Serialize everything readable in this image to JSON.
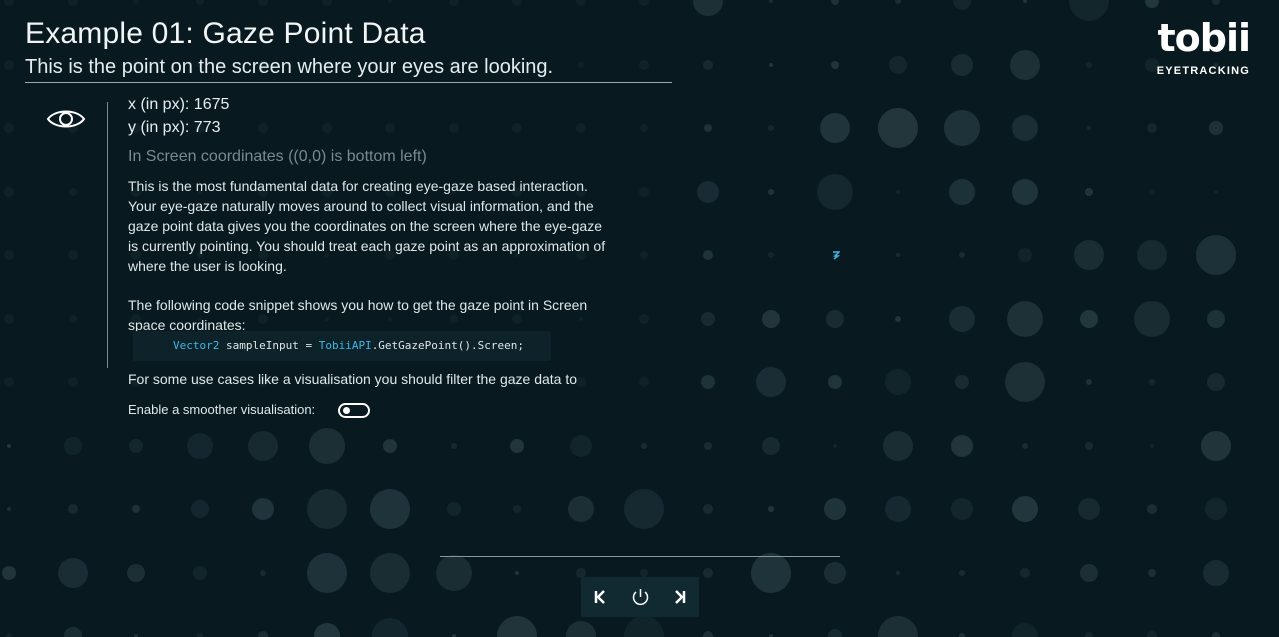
{
  "header": {
    "title": "Example 01: Gaze Point Data",
    "subtitle": "This is the point on the screen where your eyes are looking."
  },
  "logo": {
    "wordmark": "tobii",
    "tagline": "EYETRACKING"
  },
  "gaze": {
    "x_text": "x (in px): 1675",
    "y_text": "y (in px): 773",
    "coordinate_note": "In Screen coordinates ((0,0) is bottom left)"
  },
  "description": "This is the most fundamental data for creating eye-gaze based interaction. Your eye-gaze naturally moves around to collect visual information, and the gaze point data gives you the coordinates on the screen where the eye-gaze is currently pointing. You should treat each gaze point as an approximation of where the user is looking.",
  "snippet_intro": "The following code snippet shows you how to get the gaze point in Screen space coordinates:",
  "code": {
    "type": "Vector2",
    "var": " sampleInput = ",
    "api": "TobiiAPI",
    "rest": ".GetGazePoint().Screen;"
  },
  "filter_text": "For some use cases like a visualisation you should filter the gaze data to",
  "smoothing": {
    "label": "Enable a smoother visualisation:",
    "enabled": false
  },
  "nav": {
    "prev": "previous-example",
    "power": "exit",
    "next": "next-example"
  },
  "colors": {
    "background": "#081a20",
    "accent": "#3fb6e8",
    "dot": "#1c3138"
  }
}
